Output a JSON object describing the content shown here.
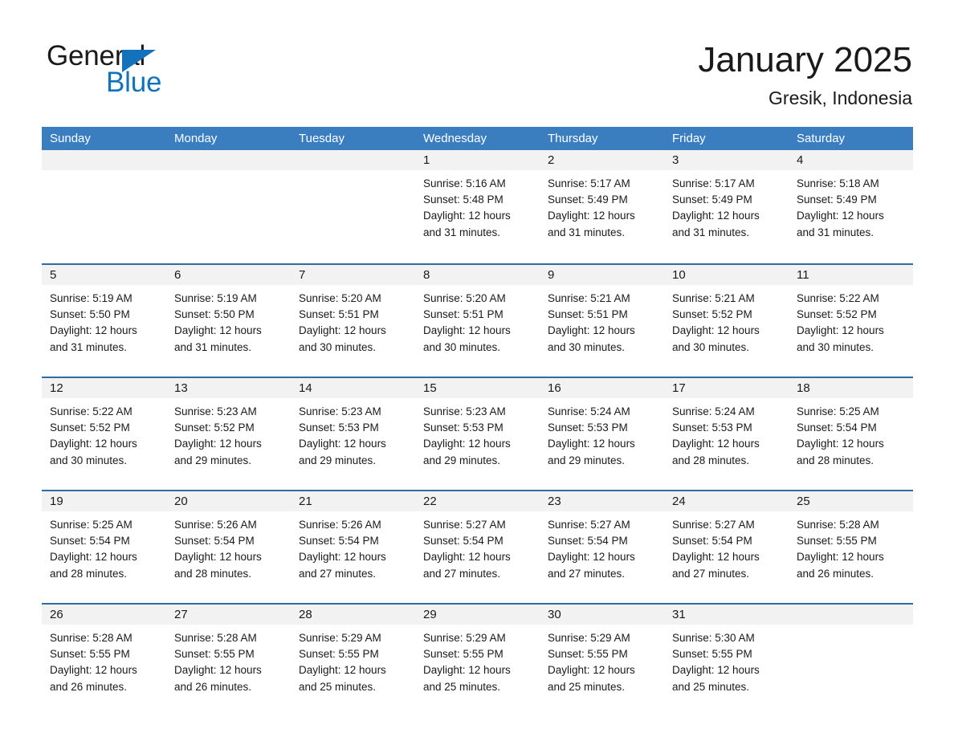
{
  "brand": {
    "name_line1": "General",
    "name_line2": "Blue",
    "accent_color": "#1272bb"
  },
  "header": {
    "month_title": "January 2025",
    "location": "Gresik, Indonesia"
  },
  "calendar": {
    "header_bg": "#3a7ebf",
    "row_divider_color": "#2e6da4",
    "day_band_bg": "#f2f2f2",
    "weekday_headers": [
      "Sunday",
      "Monday",
      "Tuesday",
      "Wednesday",
      "Thursday",
      "Friday",
      "Saturday"
    ],
    "weeks": [
      [
        {
          "day": "",
          "sunrise": "",
          "sunset": "",
          "daylight_line1": "",
          "daylight_line2": "",
          "empty": true
        },
        {
          "day": "",
          "sunrise": "",
          "sunset": "",
          "daylight_line1": "",
          "daylight_line2": "",
          "empty": true
        },
        {
          "day": "",
          "sunrise": "",
          "sunset": "",
          "daylight_line1": "",
          "daylight_line2": "",
          "empty": true
        },
        {
          "day": "1",
          "sunrise": "Sunrise: 5:16 AM",
          "sunset": "Sunset: 5:48 PM",
          "daylight_line1": "Daylight: 12 hours",
          "daylight_line2": "and 31 minutes.",
          "empty": false
        },
        {
          "day": "2",
          "sunrise": "Sunrise: 5:17 AM",
          "sunset": "Sunset: 5:49 PM",
          "daylight_line1": "Daylight: 12 hours",
          "daylight_line2": "and 31 minutes.",
          "empty": false
        },
        {
          "day": "3",
          "sunrise": "Sunrise: 5:17 AM",
          "sunset": "Sunset: 5:49 PM",
          "daylight_line1": "Daylight: 12 hours",
          "daylight_line2": "and 31 minutes.",
          "empty": false
        },
        {
          "day": "4",
          "sunrise": "Sunrise: 5:18 AM",
          "sunset": "Sunset: 5:49 PM",
          "daylight_line1": "Daylight: 12 hours",
          "daylight_line2": "and 31 minutes.",
          "empty": false
        }
      ],
      [
        {
          "day": "5",
          "sunrise": "Sunrise: 5:19 AM",
          "sunset": "Sunset: 5:50 PM",
          "daylight_line1": "Daylight: 12 hours",
          "daylight_line2": "and 31 minutes.",
          "empty": false
        },
        {
          "day": "6",
          "sunrise": "Sunrise: 5:19 AM",
          "sunset": "Sunset: 5:50 PM",
          "daylight_line1": "Daylight: 12 hours",
          "daylight_line2": "and 31 minutes.",
          "empty": false
        },
        {
          "day": "7",
          "sunrise": "Sunrise: 5:20 AM",
          "sunset": "Sunset: 5:51 PM",
          "daylight_line1": "Daylight: 12 hours",
          "daylight_line2": "and 30 minutes.",
          "empty": false
        },
        {
          "day": "8",
          "sunrise": "Sunrise: 5:20 AM",
          "sunset": "Sunset: 5:51 PM",
          "daylight_line1": "Daylight: 12 hours",
          "daylight_line2": "and 30 minutes.",
          "empty": false
        },
        {
          "day": "9",
          "sunrise": "Sunrise: 5:21 AM",
          "sunset": "Sunset: 5:51 PM",
          "daylight_line1": "Daylight: 12 hours",
          "daylight_line2": "and 30 minutes.",
          "empty": false
        },
        {
          "day": "10",
          "sunrise": "Sunrise: 5:21 AM",
          "sunset": "Sunset: 5:52 PM",
          "daylight_line1": "Daylight: 12 hours",
          "daylight_line2": "and 30 minutes.",
          "empty": false
        },
        {
          "day": "11",
          "sunrise": "Sunrise: 5:22 AM",
          "sunset": "Sunset: 5:52 PM",
          "daylight_line1": "Daylight: 12 hours",
          "daylight_line2": "and 30 minutes.",
          "empty": false
        }
      ],
      [
        {
          "day": "12",
          "sunrise": "Sunrise: 5:22 AM",
          "sunset": "Sunset: 5:52 PM",
          "daylight_line1": "Daylight: 12 hours",
          "daylight_line2": "and 30 minutes.",
          "empty": false
        },
        {
          "day": "13",
          "sunrise": "Sunrise: 5:23 AM",
          "sunset": "Sunset: 5:52 PM",
          "daylight_line1": "Daylight: 12 hours",
          "daylight_line2": "and 29 minutes.",
          "empty": false
        },
        {
          "day": "14",
          "sunrise": "Sunrise: 5:23 AM",
          "sunset": "Sunset: 5:53 PM",
          "daylight_line1": "Daylight: 12 hours",
          "daylight_line2": "and 29 minutes.",
          "empty": false
        },
        {
          "day": "15",
          "sunrise": "Sunrise: 5:23 AM",
          "sunset": "Sunset: 5:53 PM",
          "daylight_line1": "Daylight: 12 hours",
          "daylight_line2": "and 29 minutes.",
          "empty": false
        },
        {
          "day": "16",
          "sunrise": "Sunrise: 5:24 AM",
          "sunset": "Sunset: 5:53 PM",
          "daylight_line1": "Daylight: 12 hours",
          "daylight_line2": "and 29 minutes.",
          "empty": false
        },
        {
          "day": "17",
          "sunrise": "Sunrise: 5:24 AM",
          "sunset": "Sunset: 5:53 PM",
          "daylight_line1": "Daylight: 12 hours",
          "daylight_line2": "and 28 minutes.",
          "empty": false
        },
        {
          "day": "18",
          "sunrise": "Sunrise: 5:25 AM",
          "sunset": "Sunset: 5:54 PM",
          "daylight_line1": "Daylight: 12 hours",
          "daylight_line2": "and 28 minutes.",
          "empty": false
        }
      ],
      [
        {
          "day": "19",
          "sunrise": "Sunrise: 5:25 AM",
          "sunset": "Sunset: 5:54 PM",
          "daylight_line1": "Daylight: 12 hours",
          "daylight_line2": "and 28 minutes.",
          "empty": false
        },
        {
          "day": "20",
          "sunrise": "Sunrise: 5:26 AM",
          "sunset": "Sunset: 5:54 PM",
          "daylight_line1": "Daylight: 12 hours",
          "daylight_line2": "and 28 minutes.",
          "empty": false
        },
        {
          "day": "21",
          "sunrise": "Sunrise: 5:26 AM",
          "sunset": "Sunset: 5:54 PM",
          "daylight_line1": "Daylight: 12 hours",
          "daylight_line2": "and 27 minutes.",
          "empty": false
        },
        {
          "day": "22",
          "sunrise": "Sunrise: 5:27 AM",
          "sunset": "Sunset: 5:54 PM",
          "daylight_line1": "Daylight: 12 hours",
          "daylight_line2": "and 27 minutes.",
          "empty": false
        },
        {
          "day": "23",
          "sunrise": "Sunrise: 5:27 AM",
          "sunset": "Sunset: 5:54 PM",
          "daylight_line1": "Daylight: 12 hours",
          "daylight_line2": "and 27 minutes.",
          "empty": false
        },
        {
          "day": "24",
          "sunrise": "Sunrise: 5:27 AM",
          "sunset": "Sunset: 5:54 PM",
          "daylight_line1": "Daylight: 12 hours",
          "daylight_line2": "and 27 minutes.",
          "empty": false
        },
        {
          "day": "25",
          "sunrise": "Sunrise: 5:28 AM",
          "sunset": "Sunset: 5:55 PM",
          "daylight_line1": "Daylight: 12 hours",
          "daylight_line2": "and 26 minutes.",
          "empty": false
        }
      ],
      [
        {
          "day": "26",
          "sunrise": "Sunrise: 5:28 AM",
          "sunset": "Sunset: 5:55 PM",
          "daylight_line1": "Daylight: 12 hours",
          "daylight_line2": "and 26 minutes.",
          "empty": false
        },
        {
          "day": "27",
          "sunrise": "Sunrise: 5:28 AM",
          "sunset": "Sunset: 5:55 PM",
          "daylight_line1": "Daylight: 12 hours",
          "daylight_line2": "and 26 minutes.",
          "empty": false
        },
        {
          "day": "28",
          "sunrise": "Sunrise: 5:29 AM",
          "sunset": "Sunset: 5:55 PM",
          "daylight_line1": "Daylight: 12 hours",
          "daylight_line2": "and 25 minutes.",
          "empty": false
        },
        {
          "day": "29",
          "sunrise": "Sunrise: 5:29 AM",
          "sunset": "Sunset: 5:55 PM",
          "daylight_line1": "Daylight: 12 hours",
          "daylight_line2": "and 25 minutes.",
          "empty": false
        },
        {
          "day": "30",
          "sunrise": "Sunrise: 5:29 AM",
          "sunset": "Sunset: 5:55 PM",
          "daylight_line1": "Daylight: 12 hours",
          "daylight_line2": "and 25 minutes.",
          "empty": false
        },
        {
          "day": "31",
          "sunrise": "Sunrise: 5:30 AM",
          "sunset": "Sunset: 5:55 PM",
          "daylight_line1": "Daylight: 12 hours",
          "daylight_line2": "and 25 minutes.",
          "empty": false
        },
        {
          "day": "",
          "sunrise": "",
          "sunset": "",
          "daylight_line1": "",
          "daylight_line2": "",
          "empty": true
        }
      ]
    ]
  }
}
